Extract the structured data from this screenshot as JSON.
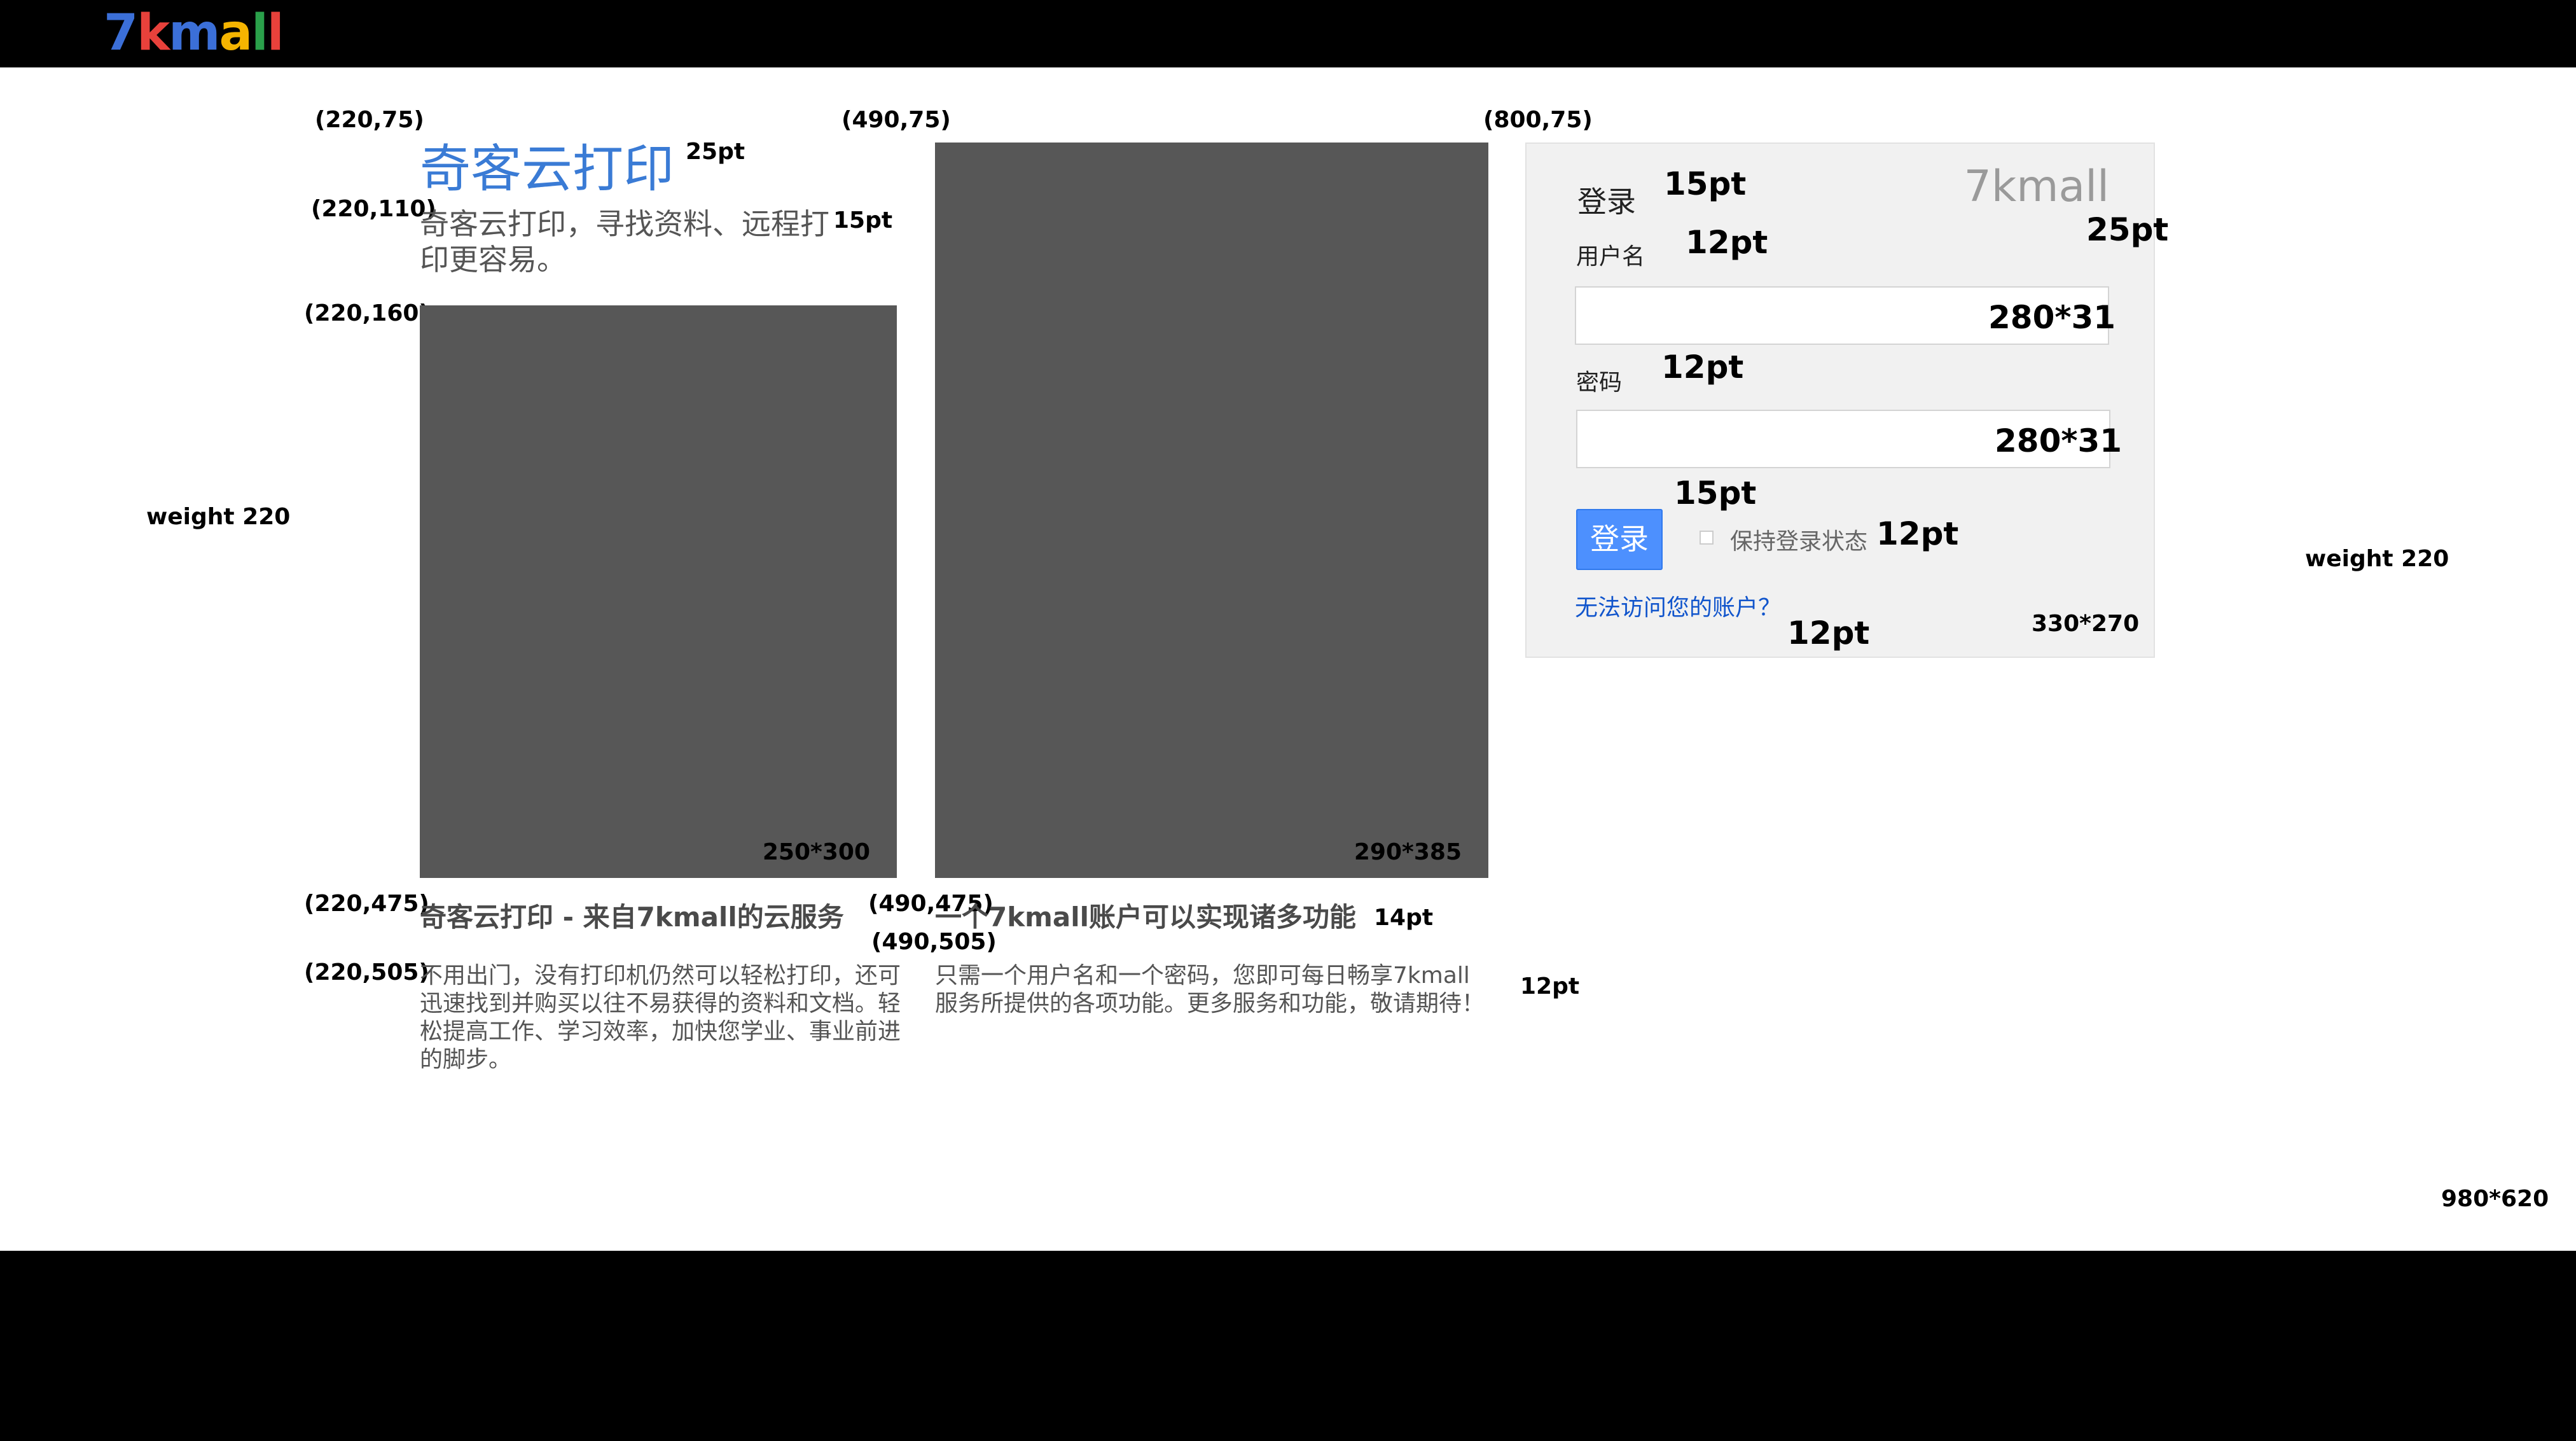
{
  "header": {
    "logo_letters": [
      "7",
      "k",
      "m",
      "a",
      "l",
      "l"
    ],
    "logo_colors": [
      "#3b6fd8",
      "#e8413b",
      "#3b6fd8",
      "#f5b400",
      "#2aa04a",
      "#e8413b"
    ]
  },
  "hero": {
    "title": "奇客云打印",
    "description": "奇客云打印，寻找资料、远程打印更容易。"
  },
  "placeholders": {
    "left_dim": "250*300",
    "middle_dim": "290*385"
  },
  "sections": {
    "left_title": "奇客云打印 - 来自7kmall的云服务",
    "left_text": "不用出门，没有打印机仍然可以轻松打印，还可迅速找到并购买以往不易获得的资料和文档。轻松提高工作、学习效率，加快您学业、事业前进的脚步。",
    "middle_title": "一个7kmall账户可以实现诸多功能",
    "middle_text": "只需一个用户名和一个密码，您即可每日畅享7kmall服务所提供的各项功能。更多服务和功能，敬请期待！"
  },
  "login": {
    "title": "登录",
    "brand": "7kmall",
    "username_label": "用户名",
    "username_value": "",
    "password_label": "密码",
    "password_value": "",
    "submit_label": "登录",
    "remember_label": "保持登录状态",
    "remember_checked": false,
    "help_link": "无法访问您的账户？"
  },
  "annotations": {
    "coord_220_75": "(220,75)",
    "coord_220_110": "(220,110)",
    "coord_220_160": "(220,160)",
    "coord_220_475": "(220,475)",
    "coord_220_505": "(220,505)",
    "coord_490_75": "(490,75)",
    "coord_490_475": "(490,475)",
    "coord_490_505": "(490,505)",
    "coord_800_75": "(800,75)",
    "pt_25_hero": "25pt",
    "pt_15_hero": "15pt",
    "pt_14_sections": "14pt",
    "pt_12_sections": "12pt",
    "pt_15_login_title": "15pt",
    "pt_25_brand": "25pt",
    "pt_12_username": "12pt",
    "pt_12_password": "12pt",
    "pt_15_button": "15pt",
    "pt_12_remember": "12pt",
    "pt_12_link": "12pt",
    "input_dim_1": "280*31",
    "input_dim_2": "280*31",
    "login_dim": "330*270",
    "weight_left": "weight 220",
    "weight_right": "weight 220",
    "page_dim": "980*620"
  }
}
